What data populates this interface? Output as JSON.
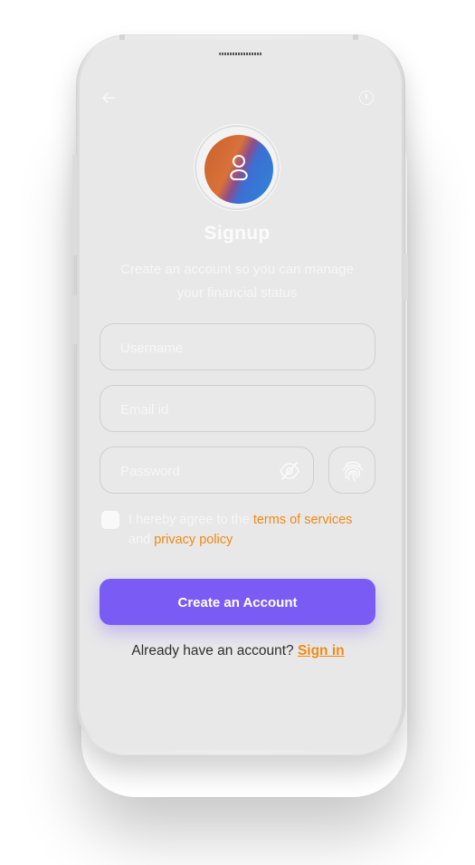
{
  "header": {
    "back_icon": "arrow-left-icon",
    "info_icon": "info-circle-icon"
  },
  "avatar": {
    "icon": "user-icon"
  },
  "title": "Signup",
  "subtitle": "Create an account so you can manage your financial status",
  "form": {
    "username_placeholder": "Username",
    "email_placeholder": "Email id",
    "password_placeholder": "Password",
    "password_toggle_icon": "eye-off-icon",
    "fingerprint_icon": "fingerprint-icon"
  },
  "agreement": {
    "prefix": "I hereby agree to the ",
    "terms_link": "terms of services",
    "middle": "and ",
    "privacy_link": "privacy policy"
  },
  "cta": {
    "label": "Create an Account"
  },
  "signin": {
    "prompt": "Already have an account? ",
    "link": "Sign in"
  },
  "colors": {
    "accent": "#7a5cf5",
    "link": "#f08a14",
    "screen": "#e8e8e8"
  }
}
